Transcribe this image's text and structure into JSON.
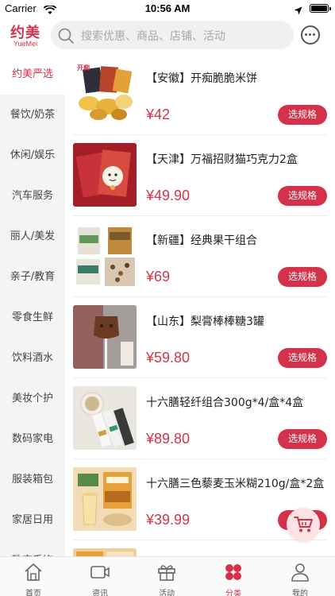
{
  "status_bar": {
    "carrier": "Carrier",
    "time": "10:56 AM"
  },
  "header": {
    "logo_cn": "约美",
    "logo_en": "YueMei",
    "search_placeholder": "搜索优惠、商品、店铺、活动"
  },
  "sidebar": {
    "items": [
      {
        "label": "约美严选",
        "active": true
      },
      {
        "label": "餐饮/奶茶"
      },
      {
        "label": "休闲/娱乐"
      },
      {
        "label": "汽车服务"
      },
      {
        "label": "丽人/美发"
      },
      {
        "label": "亲子/教育"
      },
      {
        "label": "零食生鲜"
      },
      {
        "label": "饮料酒水"
      },
      {
        "label": "美妆个护"
      },
      {
        "label": "数码家电"
      },
      {
        "label": "服装箱包"
      },
      {
        "label": "家居日用"
      },
      {
        "label": "珠宝手饰"
      }
    ]
  },
  "products": [
    {
      "name": "【安徽】开痴脆脆米饼",
      "price": "¥42",
      "button": "选规格",
      "thumb_label": "开痴"
    },
    {
      "name": "【天津】万福招财猫巧克力2盒",
      "price": "¥49.90",
      "button": "选规格"
    },
    {
      "name": "【新疆】经典果干组合",
      "price": "¥69",
      "button": "选规格"
    },
    {
      "name": "【山东】梨膏棒棒糖3罐",
      "price": "¥59.80",
      "button": "选规格"
    },
    {
      "name": "十六膳轻纤组合300g*4/盒*4盒",
      "price": "¥89.80",
      "button": "选规格"
    },
    {
      "name": "十六膳三色藜麦玉米糊210g/盒*2盒",
      "price": "¥39.99",
      "button": "选规格"
    },
    {
      "name": "",
      "price": "",
      "button": ""
    }
  ],
  "tab_bar": {
    "tabs": [
      {
        "label": "首页",
        "icon": "home-icon"
      },
      {
        "label": "资讯",
        "icon": "video-icon"
      },
      {
        "label": "活动",
        "icon": "gift-icon"
      },
      {
        "label": "分类",
        "icon": "category-icon",
        "active": true
      },
      {
        "label": "我的",
        "icon": "profile-icon"
      }
    ]
  },
  "colors": {
    "accent": "#d4324a",
    "sidebar_bg": "#f4f4f4",
    "search_bg": "#f0f0f0"
  }
}
